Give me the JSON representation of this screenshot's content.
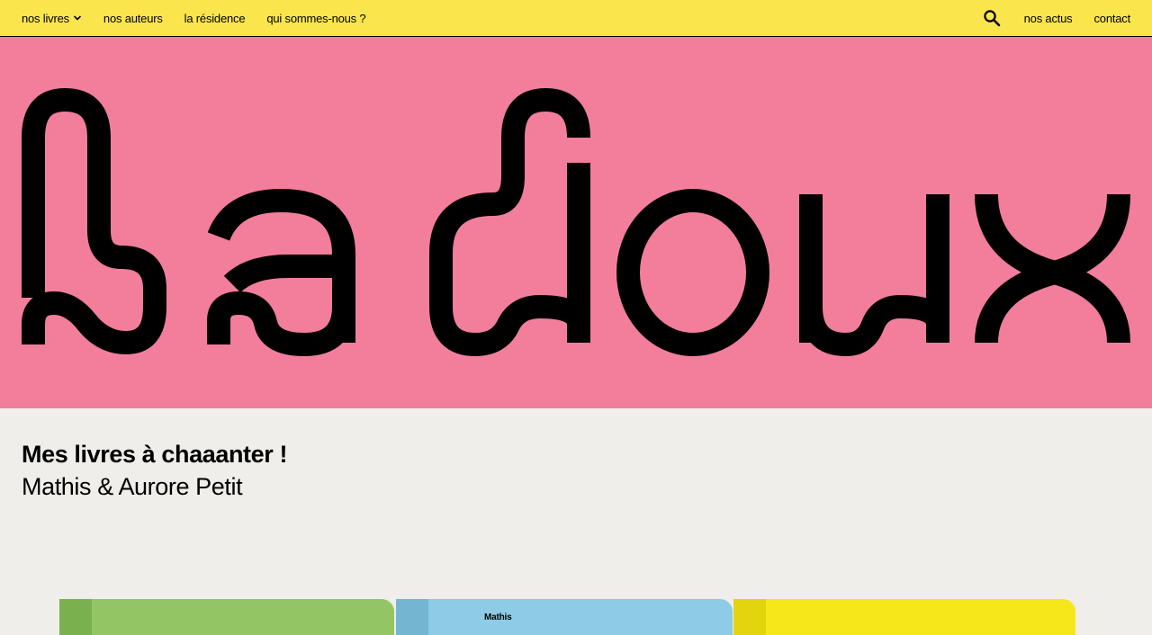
{
  "nav": {
    "left": [
      {
        "label": "nos livres",
        "has_dropdown": true
      },
      {
        "label": "nos auteurs"
      },
      {
        "label": "la résidence"
      },
      {
        "label": "qui sommes-nous ?"
      }
    ],
    "right": [
      {
        "label": "nos actus"
      },
      {
        "label": "contact"
      }
    ],
    "search_icon": "search-icon",
    "background": "#fae64c"
  },
  "hero": {
    "logo_text": "la doux",
    "background": "#f27e9c"
  },
  "book": {
    "title": "Mes livres à chaaanter !",
    "authors": "Mathis & Aurore Petit"
  },
  "covers": [
    {
      "color": "#93c565",
      "text": ""
    },
    {
      "color": "#8dcbe6",
      "text": "Mathis"
    },
    {
      "color": "#f5e71a",
      "text": ""
    }
  ]
}
